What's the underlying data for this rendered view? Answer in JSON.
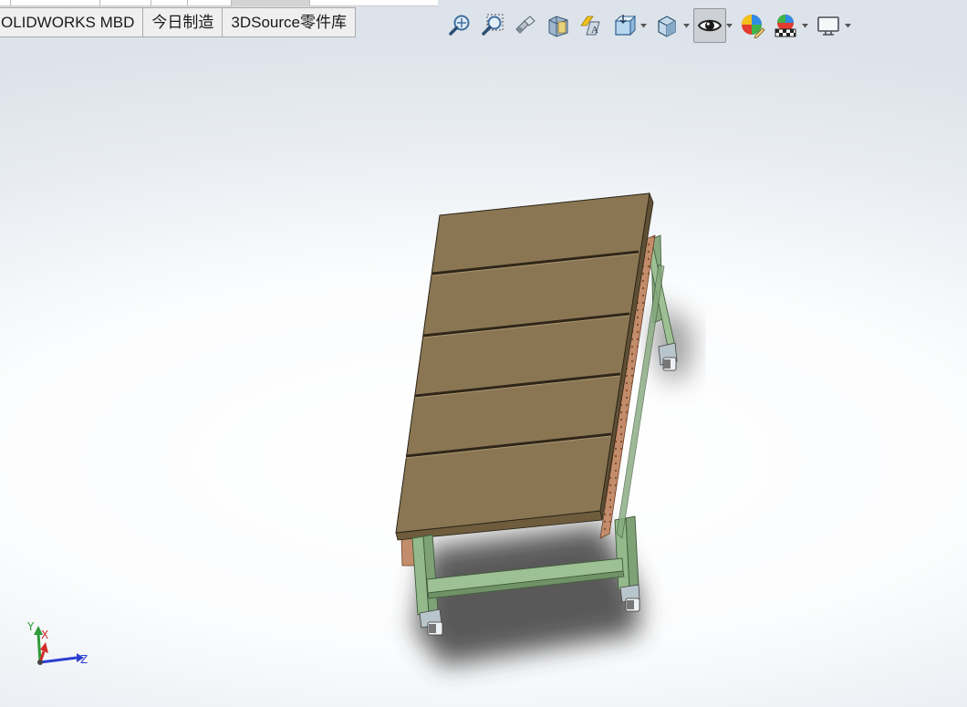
{
  "tabs": [
    {
      "label": "OLIDWORKS MBD"
    },
    {
      "label": "今日制造"
    },
    {
      "label": "3DSource零件库"
    }
  ],
  "toolbar": {
    "buttons": [
      {
        "icon": "zoom-to-fit-icon",
        "has_dropdown": false
      },
      {
        "icon": "zoom-to-area-icon",
        "has_dropdown": false
      },
      {
        "icon": "previous-view-icon",
        "has_dropdown": false
      },
      {
        "icon": "section-view-icon",
        "has_dropdown": false
      },
      {
        "icon": "dynamic-annotation-views-icon",
        "has_dropdown": false
      },
      {
        "icon": "view-orientation-icon",
        "has_dropdown": true
      },
      {
        "icon": "display-style-icon",
        "has_dropdown": true
      },
      {
        "icon": "hide-show-items-icon",
        "has_dropdown": true,
        "active": true
      },
      {
        "icon": "edit-appearance-icon",
        "has_dropdown": false
      },
      {
        "icon": "apply-scene-icon",
        "has_dropdown": true
      },
      {
        "icon": "view-settings-icon",
        "has_dropdown": true
      }
    ]
  },
  "triad": {
    "x_label": "X",
    "y_label": "Y",
    "z_label": "Z"
  },
  "colors": {
    "tab_bg": "#efefef",
    "active_button_bg": "#cdd0d4",
    "table_top": "#8a7653",
    "frame_green": "#8fb387",
    "rail_copper": "#c18a68",
    "triad_x": "#d42a2a",
    "triad_y": "#2e9a3a",
    "triad_z": "#2c3fd0"
  }
}
